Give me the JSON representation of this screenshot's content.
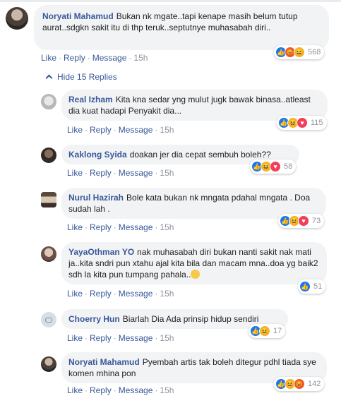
{
  "actions": {
    "like": "Like",
    "reply": "Reply",
    "message": "Message"
  },
  "hide_replies": "Hide 15 Replies",
  "comments": [
    {
      "name": "Noryati Mahamud",
      "text": "Bukan nk mgate..tapi kenape masih belum tutup aurat..sdgkn sakit itu di thp teruk..septutnye muhasabah diri..",
      "time": "15h",
      "reactions": [
        "like",
        "angry",
        "haha"
      ],
      "count": "568"
    },
    {
      "name": "Real Izham",
      "text": "Kita kna sedar yng mulut jugk bawak binasa..atleast dia kuat hadapi Penyakit dia...",
      "time": "15h",
      "reactions": [
        "like",
        "haha",
        "love"
      ],
      "count": "115"
    },
    {
      "name": "Kaklong Syida",
      "text": "doakan jer dia cepat sembuh boleh??",
      "time": "15h",
      "reactions": [
        "like",
        "haha",
        "love"
      ],
      "count": "58"
    },
    {
      "name": "Nurul Hazirah",
      "text": "Bole kata bukan nk mngata pdahal mngata . Doa sudah lah .",
      "time": "15h",
      "reactions": [
        "like",
        "haha",
        "love"
      ],
      "count": "73"
    },
    {
      "name": "YayaOthman YO",
      "text": "nak muhasabah diri bukan nanti sakit nak mati ja..kita sndri pun xtahu ajal kita bila dan macam mna..doa yg baik2 sdh la kita pun tumpang pahala..",
      "time": "15h",
      "reactions": [
        "like"
      ],
      "count": "51"
    },
    {
      "name": "Choerry Hun",
      "text": "Biarlah Dia Ada prinsip hidup sendiri",
      "time": "15h",
      "reactions": [
        "like",
        "haha"
      ],
      "count": "17"
    },
    {
      "name": "Noryati Mahamud",
      "text": "Pyembah artis tak boleh ditegur pdhl tiada sye komen mhina pon",
      "time": "15h",
      "reactions": [
        "like",
        "haha",
        "angry"
      ],
      "count": "142"
    }
  ],
  "colors": {
    "link": "#385898",
    "meta": "#90949c",
    "bubble": "#f2f3f5",
    "like": "#1877f2",
    "haha": "#f7b125",
    "angry": "#f0582a",
    "love": "#f33e58"
  }
}
